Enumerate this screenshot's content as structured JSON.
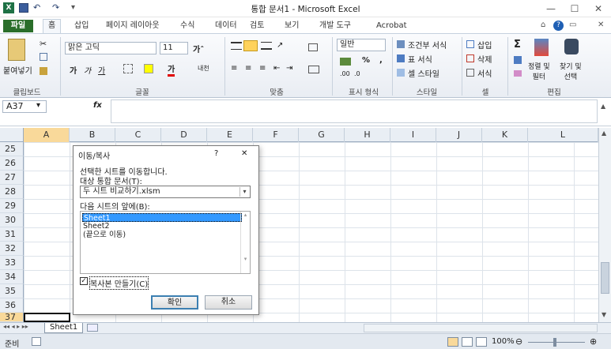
{
  "window": {
    "title": "통합 문서1 - Microsoft Excel"
  },
  "quick_access": {
    "undo": "↶",
    "redo": "↷"
  },
  "tabs": [
    "파일",
    "홈",
    "삽입",
    "페이지 레이아웃",
    "수식",
    "데이터",
    "검토",
    "보기",
    "개발 도구",
    "Acrobat"
  ],
  "ribbon": {
    "clipboard": {
      "paste": "붙여넣기",
      "label": "클립보드"
    },
    "font": {
      "name": "맑은 고딕",
      "size": "11",
      "label": "글꼴",
      "bold": "가",
      "italic": "가",
      "underline": "가",
      "phonetic": "내천"
    },
    "align": {
      "label": "맞춤"
    },
    "number": {
      "format": "일반",
      "label": "표시 형식",
      "percent": "%",
      "comma": ","
    },
    "styles": {
      "cond": "조건부 서식",
      "table": "표 서식",
      "cell": "셀 스타일",
      "label": "스타일"
    },
    "cells": {
      "insert": "삽입",
      "delete": "삭제",
      "format": "서식",
      "label": "셀"
    },
    "edit": {
      "sort": "정렬 및\n필터",
      "find": "찾기 및\n선택",
      "label": "편집",
      "sigma": "Σ"
    }
  },
  "formula_bar": {
    "name_box": "A37",
    "fx": "fx",
    "value": ""
  },
  "columns": [
    "A",
    "B",
    "C",
    "D",
    "E",
    "F",
    "G",
    "H",
    "I",
    "J",
    "K",
    "L"
  ],
  "rows": [
    "25",
    "26",
    "27",
    "28",
    "29",
    "30",
    "31",
    "32",
    "33",
    "34",
    "35",
    "36",
    "37"
  ],
  "dialog": {
    "title": "이동/복사",
    "help": "?",
    "close": "✕",
    "desc": "선택한 시트를 이동합니다.",
    "target_label": "대상 통합 문서(T):",
    "target_value": "두 시트 비교하기.xlsm",
    "before_label": "다음 시트의 앞에(B):",
    "sheets": [
      "Sheet1",
      "Sheet2",
      "(끝으로 이동)"
    ],
    "selected_sheet": "Sheet1",
    "copy_label": "복사본 만들기(C)",
    "copy_checked": true,
    "ok": "확인",
    "cancel": "취소"
  },
  "sheet_tabs": [
    "Sheet1"
  ],
  "status": {
    "mode": "준비",
    "zoom": "100%"
  },
  "colors": {
    "file_tab": "#2a6e2a",
    "selection": "#3399ff"
  }
}
